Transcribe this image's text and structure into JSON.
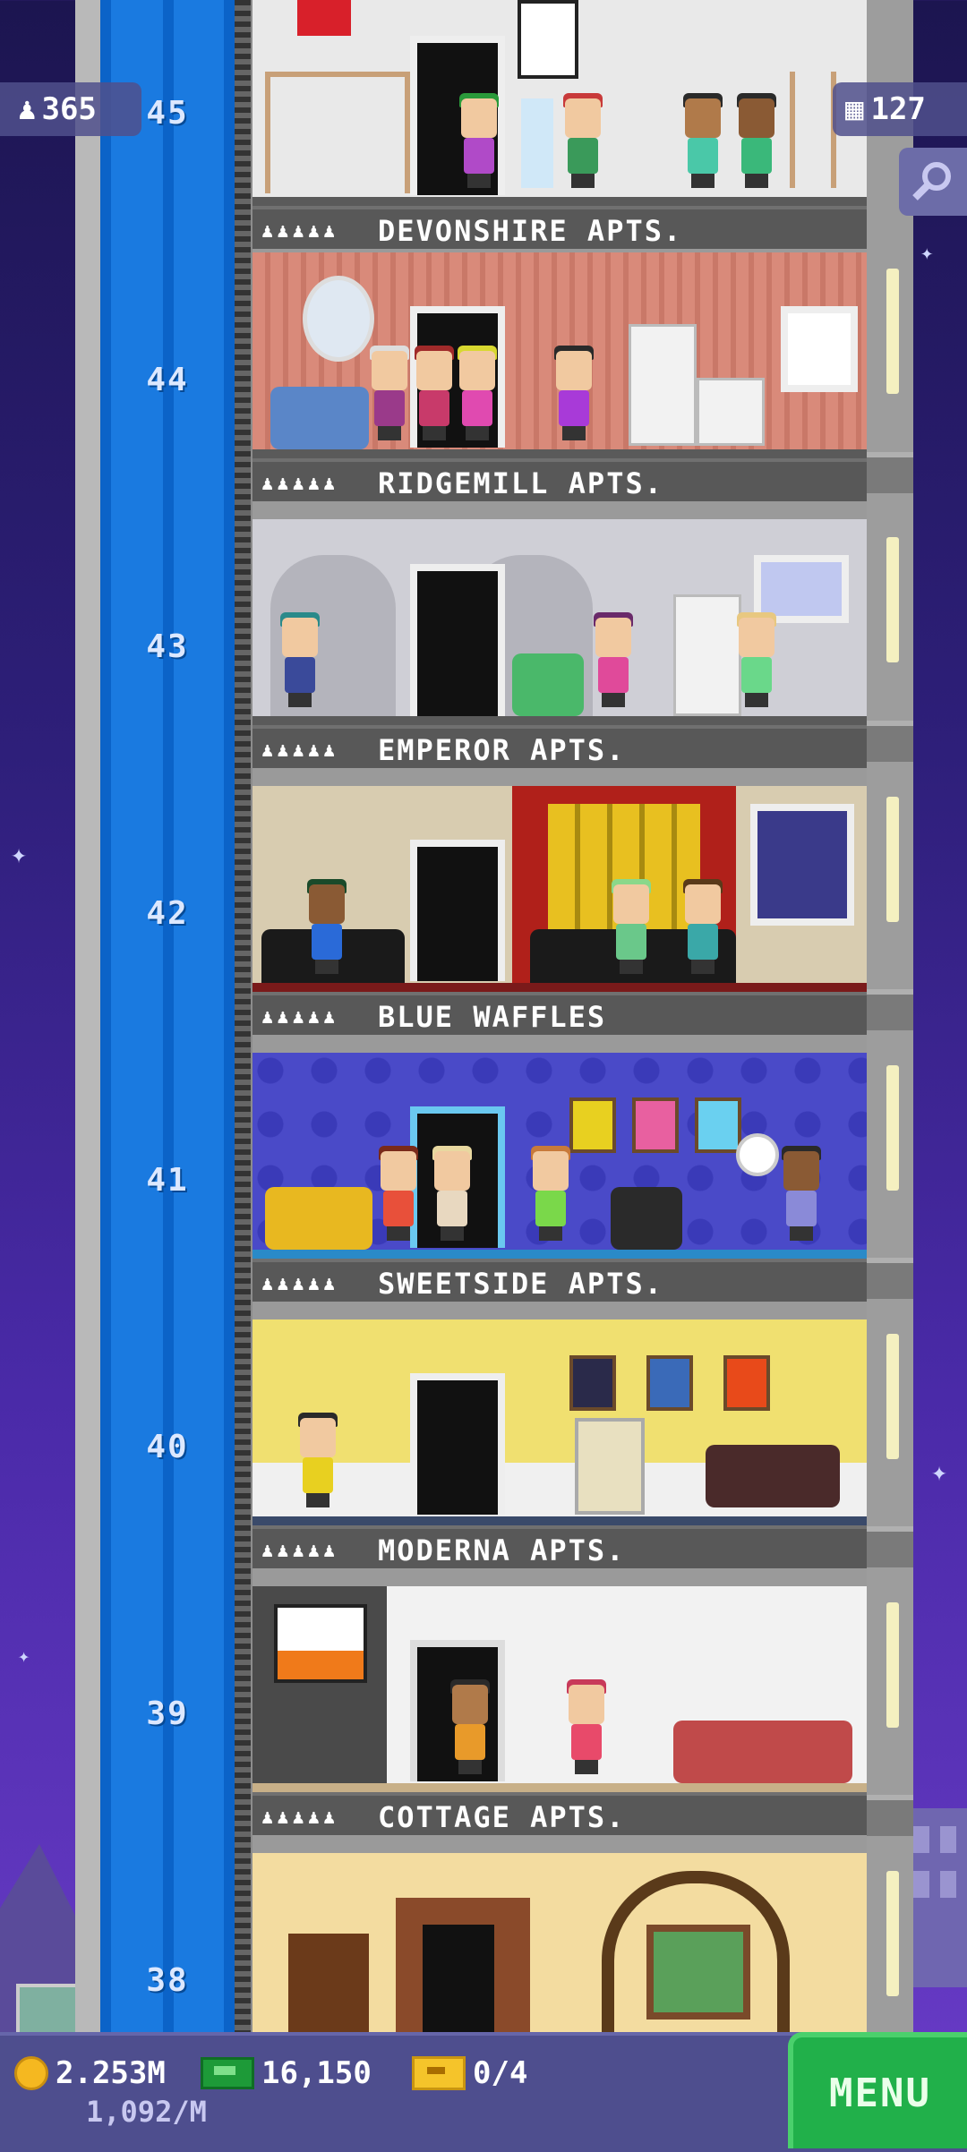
{
  "hud": {
    "population": "365",
    "floors": "127"
  },
  "floors": [
    {
      "number": "45",
      "name": "DEVONSHIRE APTS.",
      "residents": "♟♟♟♟♟",
      "wall": "#e9e9e9"
    },
    {
      "number": "44",
      "name": "RIDGEMILL APTS.",
      "residents": "♟♟♟♟♟",
      "wall": "#d98a7a"
    },
    {
      "number": "43",
      "name": "EMPEROR APTS.",
      "residents": "♟♟♟♟♟",
      "wall": "#cfcfd6"
    },
    {
      "number": "42",
      "name": "BLUE WAFFLES",
      "residents": "♟♟♟♟♟",
      "wall": "#d8ccb0"
    },
    {
      "number": "41",
      "name": "SWEETSIDE APTS.",
      "residents": "♟♟♟♟♟",
      "wall": "#4a4ac8"
    },
    {
      "number": "40",
      "name": "MODERNA APTS.",
      "residents": "♟♟♟♟♟",
      "wall": "#f0e070"
    },
    {
      "number": "39",
      "name": "COTTAGE APTS.",
      "residents": "♟♟♟♟♟",
      "wall": "#f2f2f2"
    },
    {
      "number": "38",
      "name": "",
      "residents": "",
      "wall": "#f3dca0"
    }
  ],
  "bottom_bar": {
    "coins": "2.253M",
    "bux": "16,150",
    "tickets": "0/4",
    "rate": "1,092/M",
    "menu_label": "MENU"
  },
  "icons": {
    "population": "person-icon",
    "floors": "building-icon",
    "search": "magnifier-icon",
    "coins": "coin-icon",
    "bux": "bux-icon",
    "tickets": "ticket-icon"
  },
  "colors": {
    "elevator": "#1a7ae0",
    "menu": "#21b04a",
    "hud_bg": "#50508c"
  }
}
